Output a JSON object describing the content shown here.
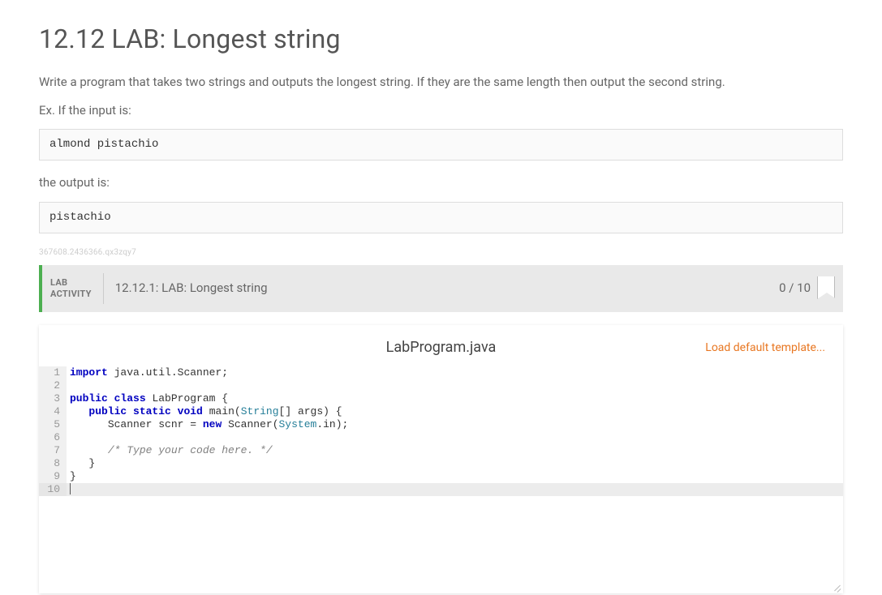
{
  "page": {
    "title": "12.12 LAB: Longest string",
    "prompt": "Write a program that takes two strings and outputs the longest string. If they are the same length then output the second string.",
    "example_intro": "Ex. If the input is:",
    "example_input": "almond pistachio",
    "output_intro": "the output is:",
    "example_output": "pistachio",
    "watermark": "367608.2436366.qx3zqy7"
  },
  "activity": {
    "type_line1": "LAB",
    "type_line2": "ACTIVITY",
    "title": "12.12.1: LAB: Longest string",
    "score": "0 / 10"
  },
  "editor": {
    "filename": "LabProgram.java",
    "load_template_label": "Load default template...",
    "code_tokens": [
      [
        [
          "kw",
          "import"
        ],
        [
          "",
          " "
        ],
        [
          "id",
          "java.util.Scanner"
        ],
        [
          "",
          ";"
        ]
      ],
      [],
      [
        [
          "kw",
          "public"
        ],
        [
          "",
          " "
        ],
        [
          "kw",
          "class"
        ],
        [
          "",
          " "
        ],
        [
          "id",
          "LabProgram"
        ],
        [
          "",
          " {"
        ]
      ],
      [
        [
          "",
          "   "
        ],
        [
          "kw",
          "public"
        ],
        [
          "",
          " "
        ],
        [
          "kw",
          "static"
        ],
        [
          "",
          " "
        ],
        [
          "kw",
          "void"
        ],
        [
          "",
          " "
        ],
        [
          "id",
          "main"
        ],
        [
          "",
          "("
        ],
        [
          "type",
          "String"
        ],
        [
          "",
          "[] "
        ],
        [
          "id",
          "args"
        ],
        [
          "",
          ") {"
        ]
      ],
      [
        [
          "",
          "      "
        ],
        [
          "id",
          "Scanner"
        ],
        [
          "",
          " "
        ],
        [
          "id",
          "scnr"
        ],
        [
          "",
          " = "
        ],
        [
          "kw",
          "new"
        ],
        [
          "",
          " "
        ],
        [
          "id",
          "Scanner"
        ],
        [
          "",
          "("
        ],
        [
          "type",
          "System"
        ],
        [
          "",
          "."
        ],
        [
          "id",
          "in"
        ],
        [
          "",
          ");"
        ]
      ],
      [],
      [
        [
          "",
          "      "
        ],
        [
          "com",
          "/* Type your code here. */"
        ]
      ],
      [
        [
          "",
          "   }"
        ]
      ],
      [
        [
          "",
          "}"
        ]
      ],
      []
    ],
    "active_line": 10
  }
}
